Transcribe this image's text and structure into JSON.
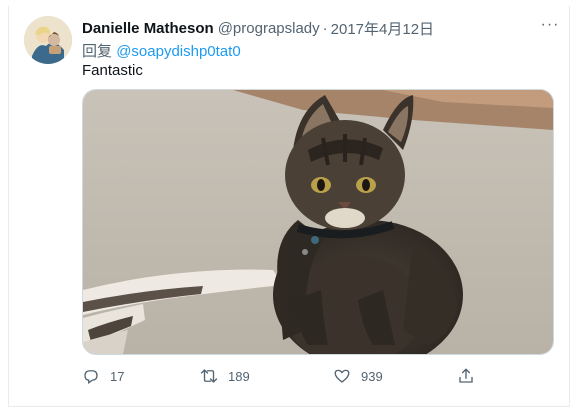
{
  "tweet": {
    "author_name": "Danielle Matheson",
    "author_handle": "@prograpslady",
    "separator": "·",
    "date": "2017年4月12日",
    "reply_prefix": "回复",
    "reply_to": "@soapydishp0tat0",
    "text": "Fantastic",
    "more_label": "···"
  },
  "actions": {
    "reply_count": "17",
    "retweet_count": "189",
    "like_count": "939"
  },
  "colors": {
    "link": "#1d9bf0",
    "muted": "#536471",
    "text": "#0f1419"
  }
}
